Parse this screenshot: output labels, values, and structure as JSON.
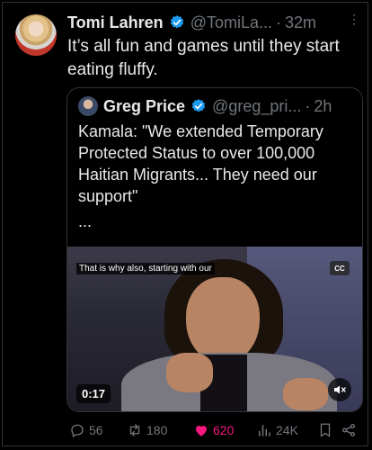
{
  "tweet": {
    "author_name": "Tomi Lahren",
    "handle": "@TomiLa...",
    "separator": "·",
    "time": "32m",
    "text": "It’s all fun and games until they start eating fluffy."
  },
  "quoted_tweet": {
    "author_name": "Greg Price",
    "handle": "@greg_pri...",
    "separator": "·",
    "time": "2h",
    "text": "Kamala: \"We extended Temporary Protected Status to over 100,000 Haitian Migrants... They need our support\"",
    "ellipsis": "...",
    "video": {
      "caption": "That is why also, starting with our",
      "cc_label": "CC",
      "duration": "0:17"
    }
  },
  "actions": {
    "replies": "56",
    "reposts": "180",
    "likes": "620",
    "views": "24K"
  },
  "colors": {
    "background": "#000000",
    "verified": "#1d9bf0",
    "like": "#f91880",
    "muted_text": "#71767b"
  },
  "icons": [
    "reply-icon",
    "repost-icon",
    "like-icon",
    "views-icon",
    "bookmark-icon",
    "share-icon",
    "verified-badge-icon",
    "mute-icon"
  ]
}
